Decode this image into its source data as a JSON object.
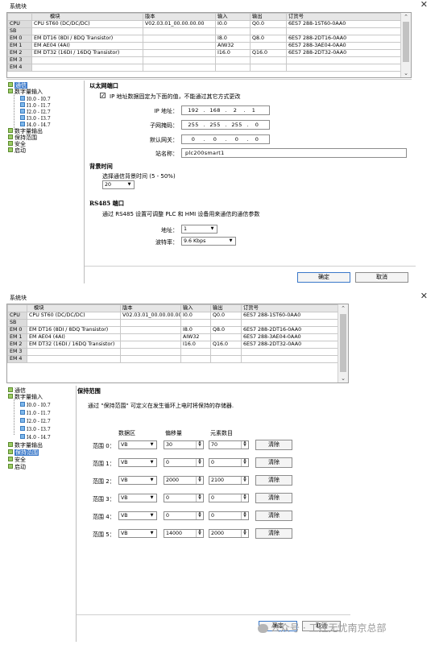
{
  "dialog1": {
    "title": "系统块",
    "close_glyph": "✕",
    "table": {
      "headers": [
        "",
        "模块",
        "版本",
        "输入",
        "输出",
        "订货号"
      ],
      "rows": [
        {
          "slot": "CPU",
          "module": "CPU ST60 (DC/DC/DC)",
          "version": "V02.03.01_00.00.00.00",
          "input": "I0.0",
          "output": "Q0.0",
          "order": "6ES7 288-1ST60-0AA0"
        },
        {
          "slot": "SB",
          "module": "",
          "version": "",
          "input": "",
          "output": "",
          "order": ""
        },
        {
          "slot": "EM 0",
          "module": "EM DT16 (8DI / 8DQ Transistor)",
          "version": "",
          "input": "I8.0",
          "output": "Q8.0",
          "order": "6ES7 288-2DT16-0AA0"
        },
        {
          "slot": "EM 1",
          "module": "EM AE04 (4AI)",
          "version": "",
          "input": "AIW32",
          "output": "",
          "order": "6ES7 288-3AE04-0AA0"
        },
        {
          "slot": "EM 2",
          "module": "EM DT32 (16DI / 16DQ Transistor)",
          "version": "",
          "input": "I16.0",
          "output": "Q16.0",
          "order": "6ES7 288-2DT32-0AA0"
        },
        {
          "slot": "EM 3",
          "module": "",
          "version": "",
          "input": "",
          "output": "",
          "order": ""
        },
        {
          "slot": "EM 4",
          "module": "",
          "version": "",
          "input": "",
          "output": "",
          "order": ""
        }
      ]
    },
    "tree": {
      "comm": "通信",
      "din": "数字量输入",
      "din_children": [
        "I0.0 - I0.7",
        "I1.0 - I1.7",
        "I2.0 - I2.7",
        "I3.0 - I3.7",
        "I4.0 - I4.7"
      ],
      "dout": "数字量输出",
      "retentive": "保持范围",
      "security": "安全",
      "startup": "启动"
    },
    "ethernet": {
      "heading": "以太网端口",
      "fixed_check_label": "IP 地址数据固定为下面的值，不能通过其它方式更改",
      "fixed_checked": "✓",
      "ip_label": "IP 地址：",
      "ip": [
        "192",
        "168",
        "2",
        "1"
      ],
      "mask_label": "子网掩码：",
      "mask": [
        "255",
        "255",
        "255",
        "0"
      ],
      "gateway_label": "默认网关：",
      "gateway": [
        "0",
        "0",
        "0",
        "0"
      ],
      "station_label": "站名称：",
      "station": "plc200smart1"
    },
    "background": {
      "heading": "背景时间",
      "desc": "选择通信背景时间 (5 - 50%)",
      "value": "20"
    },
    "rs485": {
      "heading": "RS485 端口",
      "desc": "通过 RS485 设置可调整 PLC 和 HMI 设备用来通信的通信参数",
      "addr_label": "地址：",
      "addr": "1",
      "baud_label": "波特率：",
      "baud": "9.6 Kbps"
    },
    "ok": "确定",
    "cancel": "取消"
  },
  "dialog2": {
    "title": "系统块",
    "close_glyph": "✕",
    "retentive": {
      "heading": "保持范围",
      "desc": "通过 \"保持范围\" 可定义在发生循环上电时将保持的存储器.",
      "col_area": "数据区",
      "col_offset": "偏移量",
      "col_count": "元素数目",
      "clear": "清除",
      "ranges": [
        {
          "label": "范围 0：",
          "area": "VB",
          "offset": "30",
          "count": "70"
        },
        {
          "label": "范围 1：",
          "area": "VB",
          "offset": "0",
          "count": "0"
        },
        {
          "label": "范围 2：",
          "area": "VB",
          "offset": "2000",
          "count": "2100"
        },
        {
          "label": "范围 3：",
          "area": "VB",
          "offset": "0",
          "count": "0"
        },
        {
          "label": "范围 4：",
          "area": "VB",
          "offset": "0",
          "count": "0"
        },
        {
          "label": "范围 5：",
          "area": "VB",
          "offset": "14000",
          "count": "2000"
        }
      ]
    },
    "ok": "确定",
    "cancel": "取消"
  },
  "watermark": "公众号 · 工控无忧南京总部"
}
